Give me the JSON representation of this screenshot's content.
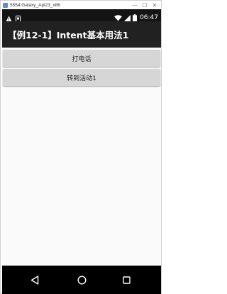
{
  "window": {
    "title": "5554:Galaxy_Api23_x86",
    "minimize_glyph": "—",
    "maximize_glyph": "☐",
    "close_glyph": "✕"
  },
  "status_bar": {
    "time": "06:47",
    "icons": [
      "warning-icon",
      "notification-icon",
      "wifi-icon",
      "signal-icon",
      "battery-icon"
    ]
  },
  "action_bar": {
    "title": "【例12-1】Intent基本用法1"
  },
  "main": {
    "buttons": [
      {
        "label": "打电话"
      },
      {
        "label": "转到活动1"
      }
    ]
  },
  "nav_bar": {
    "icons": [
      "back-icon",
      "home-icon",
      "recents-icon"
    ]
  }
}
